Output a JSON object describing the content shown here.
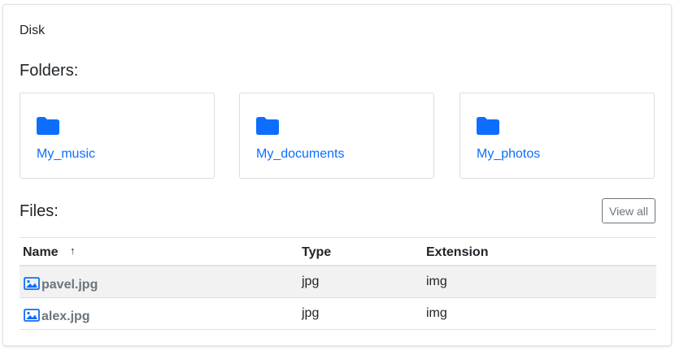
{
  "breadcrumb": {
    "label": "Disk"
  },
  "folders": {
    "title": "Folders:",
    "items": [
      {
        "name": "My_music",
        "icon": "folder-icon"
      },
      {
        "name": "My_documents",
        "icon": "folder-icon"
      },
      {
        "name": "My_photos",
        "icon": "folder-icon"
      }
    ]
  },
  "files": {
    "title": "Files:",
    "view_all_label": "View all",
    "columns": {
      "name": "Name",
      "type": "Type",
      "extension": "Extension"
    },
    "sort_indicator": "↑",
    "rows": [
      {
        "name": "pavel.jpg",
        "type": "jpg",
        "extension": "img",
        "icon": "image-icon"
      },
      {
        "name": "alex.jpg",
        "type": "jpg",
        "extension": "img",
        "icon": "image-icon"
      }
    ]
  },
  "colors": {
    "accent": "#0d6efd",
    "muted": "#6c757d",
    "stripe": "#f2f2f2"
  }
}
